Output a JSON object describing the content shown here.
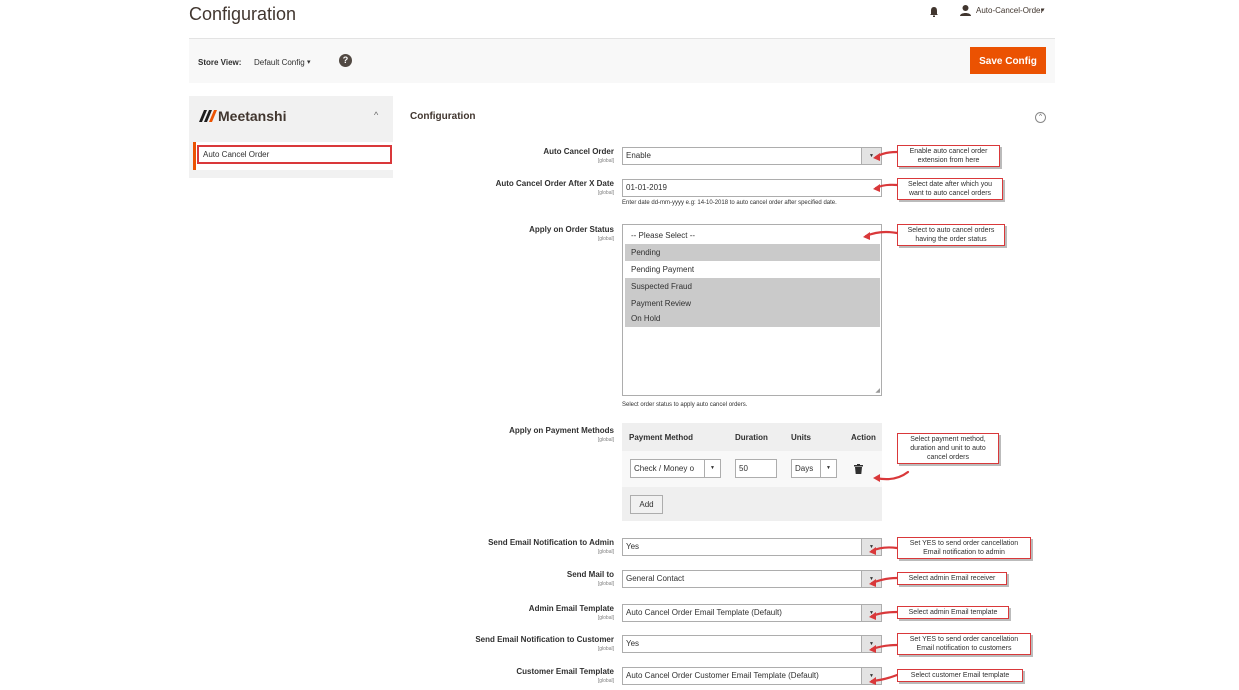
{
  "page": {
    "title": "Configuration"
  },
  "topbar": {
    "user": "Auto-Cancel-Order"
  },
  "store_view": {
    "label": "Store View:",
    "value": "Default Config",
    "save_label": "Save Config"
  },
  "sidebar": {
    "brand": "Meetanshi",
    "item": "Auto Cancel Order"
  },
  "section": {
    "title": "Configuration"
  },
  "fields": {
    "auto_cancel": {
      "label": "Auto Cancel Order",
      "scope": "[global]",
      "value": "Enable"
    },
    "after_date": {
      "label": "Auto Cancel Order After X Date",
      "scope": "[global]",
      "value": "01-01-2019",
      "note": "Enter date dd-mm-yyyy e.g: 14-10-2018 to auto cancel order after specified date."
    },
    "order_status": {
      "label": "Apply on Order Status",
      "scope": "[global]",
      "options": [
        "-- Please Select --",
        "Pending",
        "Pending Payment",
        "Suspected Fraud",
        "Payment Review",
        "On Hold"
      ],
      "note": "Select order status to apply auto cancel orders."
    },
    "payment_methods": {
      "label": "Apply on Payment Methods",
      "scope": "[global]",
      "headers": [
        "Payment Method",
        "Duration",
        "Units",
        "Action"
      ],
      "row": {
        "method": "Check / Money o",
        "duration": "50",
        "units": "Days"
      },
      "add_label": "Add"
    },
    "email_admin": {
      "label": "Send Email Notification to Admin",
      "scope": "[global]",
      "value": "Yes"
    },
    "send_mail_to": {
      "label": "Send Mail to",
      "scope": "[global]",
      "value": "General Contact"
    },
    "admin_template": {
      "label": "Admin Email Template",
      "scope": "[global]",
      "value": "Auto Cancel Order Email Template (Default)"
    },
    "email_customer": {
      "label": "Send Email Notification to Customer",
      "scope": "[global]",
      "value": "Yes"
    },
    "customer_template": {
      "label": "Customer Email Template",
      "scope": "[global]",
      "value": "Auto Cancel Order Customer Email Template (Default)"
    }
  },
  "callouts": {
    "c1": [
      "Enable auto cancel order",
      "extension from here"
    ],
    "c2": [
      "Select date after which you",
      "want to auto cancel orders"
    ],
    "c3": [
      "Select to auto cancel orders",
      "having the order status"
    ],
    "c4": [
      "Select payment method,",
      "duration and unit to auto",
      "cancel orders"
    ],
    "c5": [
      "Set YES to send order cancellation",
      "Email notification to admin"
    ],
    "c6": [
      "Select admin Email receiver"
    ],
    "c7": [
      "Select admin Email template"
    ],
    "c8": [
      "Set YES to send order cancellation",
      "Email notification to customers"
    ],
    "c9": [
      "Select customer Email template"
    ]
  },
  "colors": {
    "accent": "#eb5202",
    "callout_border": "#d9383a",
    "selected_option": "#cacaca"
  }
}
